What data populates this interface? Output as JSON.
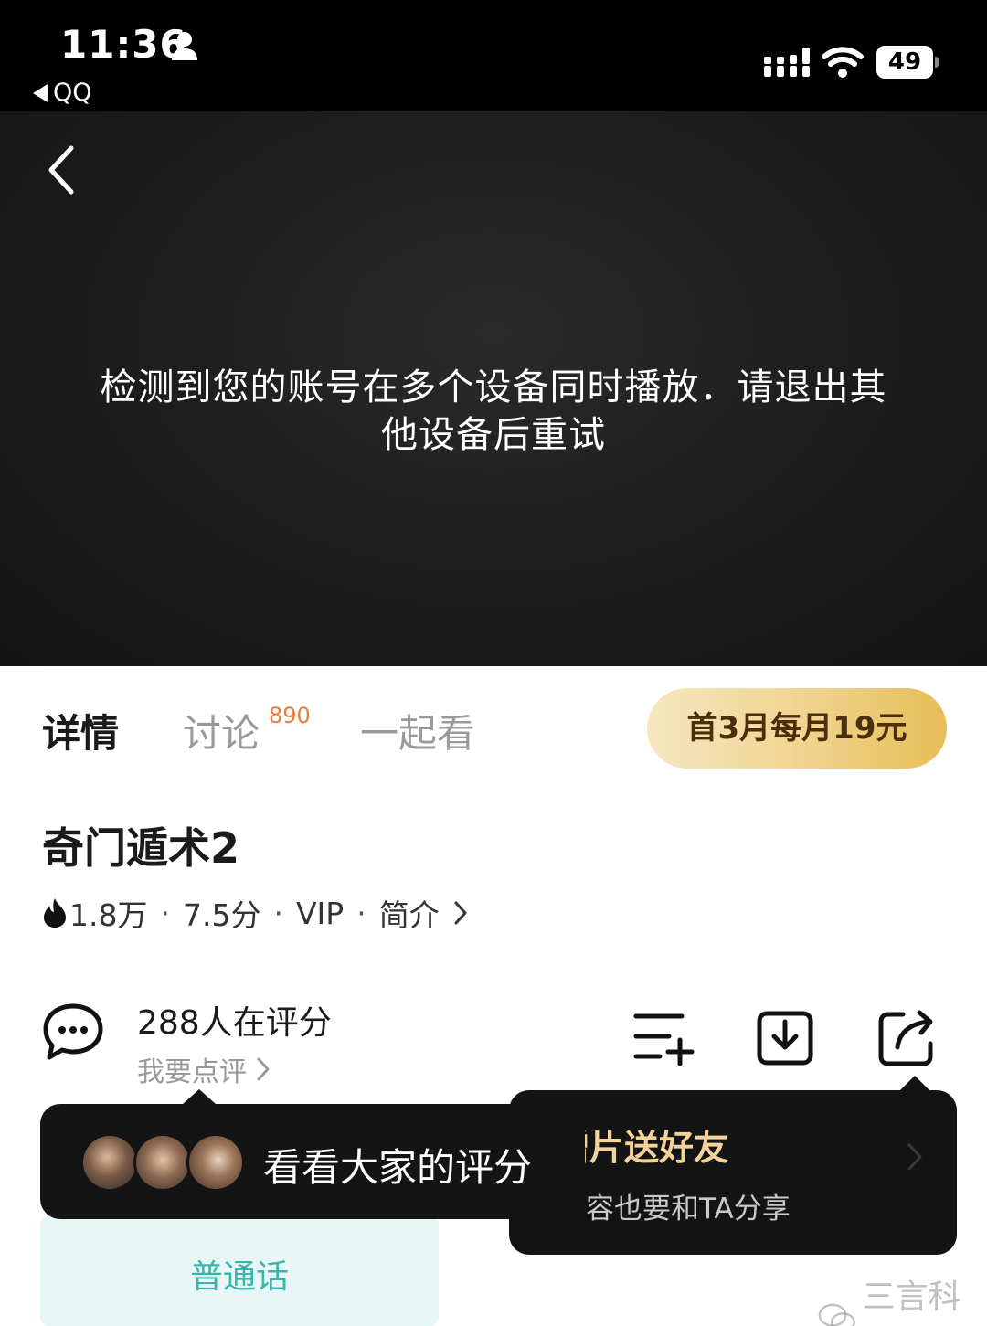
{
  "status_bar": {
    "time": "11:36",
    "back_app": "QQ",
    "battery": "49"
  },
  "player": {
    "message": "检测到您的账号在多个设备同时播放．请退出其他设备后重试"
  },
  "tabs": [
    {
      "label": "详情",
      "active": true
    },
    {
      "label": "讨论",
      "badge": "890"
    },
    {
      "label": "一起看"
    }
  ],
  "vip_button": {
    "label": "首3月每月19元"
  },
  "title": "奇门遁术2",
  "meta": {
    "heat": "1.8万",
    "score": "7.5分",
    "vip": "VIP",
    "intro": "简介"
  },
  "rating": {
    "count_text": "288人在评分",
    "link_text": "我要点评"
  },
  "tooltip_share": {
    "title": "赠片送好友",
    "subtitle": "容也要和TA分享"
  },
  "tooltip_rating": {
    "label": "看看大家的评分"
  },
  "language": {
    "label": "普通话"
  },
  "watermark": "三言科技",
  "colors": {
    "accent_gold": "#e7bd55",
    "badge_orange": "#f07a3a",
    "lang_teal": "#3bb5a9"
  },
  "icons": [
    "person-icon",
    "signal-icon",
    "wifi-icon",
    "back-chevron-icon",
    "fire-icon",
    "comment-icon",
    "add-to-list-icon",
    "download-icon",
    "share-icon"
  ]
}
